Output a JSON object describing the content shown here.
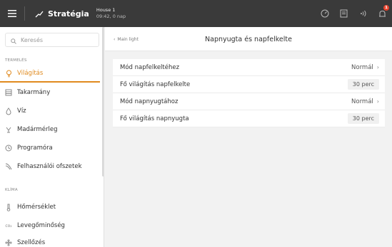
{
  "topbar": {
    "strategy_label": "Stratégia",
    "house_name": "House 1",
    "house_time": "09:42, 0 nap",
    "notification_count": "1"
  },
  "sidebar": {
    "search_placeholder": "Keresés",
    "sections": [
      {
        "header": "TERMELÉS",
        "items": [
          {
            "label": "Világítás",
            "icon": "lightbulb-icon",
            "active": true
          },
          {
            "label": "Takarmány",
            "icon": "feed-icon"
          },
          {
            "label": "Víz",
            "icon": "water-drop-icon"
          },
          {
            "label": "Madármérleg",
            "icon": "scale-icon"
          },
          {
            "label": "Programóra",
            "icon": "clock-icon"
          },
          {
            "label": "Felhasználói ofszetek",
            "icon": "offset-icon"
          }
        ]
      },
      {
        "header": "KLÍMA",
        "items": [
          {
            "label": "Hőmérséklet",
            "icon": "thermometer-icon"
          },
          {
            "label": "Levegőminőség",
            "icon": "co2-icon"
          },
          {
            "label": "Szellőzés",
            "icon": "fan-icon"
          }
        ]
      }
    ],
    "accent_color": "#e08a1e"
  },
  "main": {
    "back_label": "Main light",
    "title": "Napnyugta és napfelkelte",
    "settings": [
      {
        "label": "Mód napfelkeltéhez",
        "value": "Normál",
        "type": "select"
      },
      {
        "label": "Fő világítás napfelkelte",
        "value": "30 perc",
        "type": "chip"
      },
      {
        "label": "Mód napnyugtához",
        "value": "Normál",
        "type": "select"
      },
      {
        "label": "Fő világítás napnyugta",
        "value": "30 perc",
        "type": "chip"
      }
    ]
  }
}
